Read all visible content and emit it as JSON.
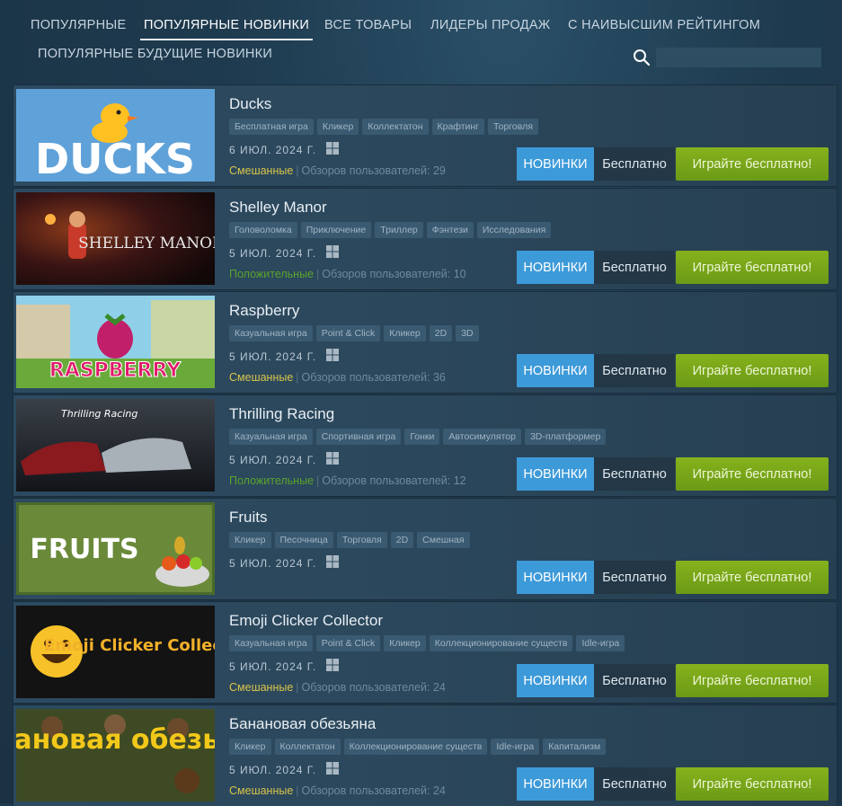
{
  "nav": {
    "tabs": [
      {
        "label": "ПОПУЛЯРНЫЕ"
      },
      {
        "label": "ПОПУЛЯРНЫЕ НОВИНКИ"
      },
      {
        "label": "ВСЕ ТОВАРЫ"
      },
      {
        "label": "ЛИДЕРЫ ПРОДАЖ"
      },
      {
        "label": "С НАИВЫСШИМ РЕЙТИНГОМ"
      },
      {
        "label": "ПОПУЛЯРНЫЕ БУДУЩИЕ НОВИНКИ"
      }
    ],
    "active_tab": "ПОПУЛЯРНЫЕ НОВИНКИ"
  },
  "search": {
    "placeholder": "",
    "icon": "search-icon"
  },
  "games": [
    {
      "name": "Ducks",
      "tags": [
        "Бесплатная игра",
        "Кликер",
        "Коллектатон",
        "Крафтинг",
        "Торговля"
      ],
      "date": "6 ИЮЛ. 2024 Г.",
      "platform": "windows-icon",
      "review_summary": "Смешанные",
      "review_sep": "|",
      "review_count": "Обзоров пользователей: 29",
      "badge": "НОВИНКИ",
      "price": "Бесплатно",
      "play": "Играйте бесплатно!",
      "capsule_text": "DUCKS"
    },
    {
      "name": "Shelley Manor",
      "tags": [
        "Головоломка",
        "Приключение",
        "Триллер",
        "Фэнтези",
        "Исследования"
      ],
      "date": "5 ИЮЛ. 2024 Г.",
      "platform": "windows-icon",
      "review_summary": "Положительные",
      "review_sep": "|",
      "review_count": "Обзоров пользователей: 10",
      "badge": "НОВИНКИ",
      "price": "Бесплатно",
      "play": "Играйте бесплатно!",
      "capsule_text": "SHELLEY MANOR"
    },
    {
      "name": "Raspberry",
      "tags": [
        "Казуальная игра",
        "Point & Click",
        "Кликер",
        "2D",
        "3D"
      ],
      "date": "5 ИЮЛ. 2024 Г.",
      "platform": "windows-icon",
      "review_summary": "Смешанные",
      "review_sep": "|",
      "review_count": "Обзоров пользователей: 36",
      "badge": "НОВИНКИ",
      "price": "Бесплатно",
      "play": "Играйте бесплатно!",
      "capsule_text": "RASPBERRY"
    },
    {
      "name": "Thrilling Racing",
      "tags": [
        "Казуальная игра",
        "Спортивная игра",
        "Гонки",
        "Автосимулятор",
        "3D-платформер"
      ],
      "date": "5 ИЮЛ. 2024 Г.",
      "platform": "windows-icon",
      "review_summary": "Положительные",
      "review_sep": "|",
      "review_count": "Обзоров пользователей: 12",
      "badge": "НОВИНКИ",
      "price": "Бесплатно",
      "play": "Играйте бесплатно!",
      "capsule_text": "Thrilling Racing"
    },
    {
      "name": "Fruits",
      "tags": [
        "Кликер",
        "Песочница",
        "Торговля",
        "2D",
        "Смешная"
      ],
      "date": "5 ИЮЛ. 2024 Г.",
      "platform": "windows-icon",
      "review_summary": "",
      "review_sep": "",
      "review_count": "",
      "badge": "НОВИНКИ",
      "price": "Бесплатно",
      "play": "Играйте бесплатно!",
      "capsule_text": "FRUITS"
    },
    {
      "name": "Emoji Clicker Collector",
      "tags": [
        "Казуальная игра",
        "Point & Click",
        "Кликер",
        "Коллекционирование существ",
        "Idle-игра"
      ],
      "date": "5 ИЮЛ. 2024 Г.",
      "platform": "windows-icon",
      "review_summary": "Смешанные",
      "review_sep": "|",
      "review_count": "Обзоров пользователей: 24",
      "badge": "НОВИНКИ",
      "price": "Бесплатно",
      "play": "Играйте бесплатно!",
      "capsule_text": "Emoji Clicker Collector"
    },
    {
      "name": "Банановая обезьяна",
      "tags": [
        "Кликер",
        "Коллектатон",
        "Коллекционирование существ",
        "Idle-игра",
        "Капитализм"
      ],
      "date": "5 ИЮЛ. 2024 Г.",
      "platform": "windows-icon",
      "review_summary": "Смешанные",
      "review_sep": "|",
      "review_count": "Обзоров пользователей: 24",
      "badge": "НОВИНКИ",
      "price": "Бесплатно",
      "play": "Играйте бесплатно!",
      "capsule_text": "Банановая обезьяна"
    }
  ],
  "colors": {
    "accent_blue": "#3d9ad9",
    "play_green": "#7aa81a",
    "mixed": "#d9c44a",
    "positive": "#5ba32b"
  }
}
